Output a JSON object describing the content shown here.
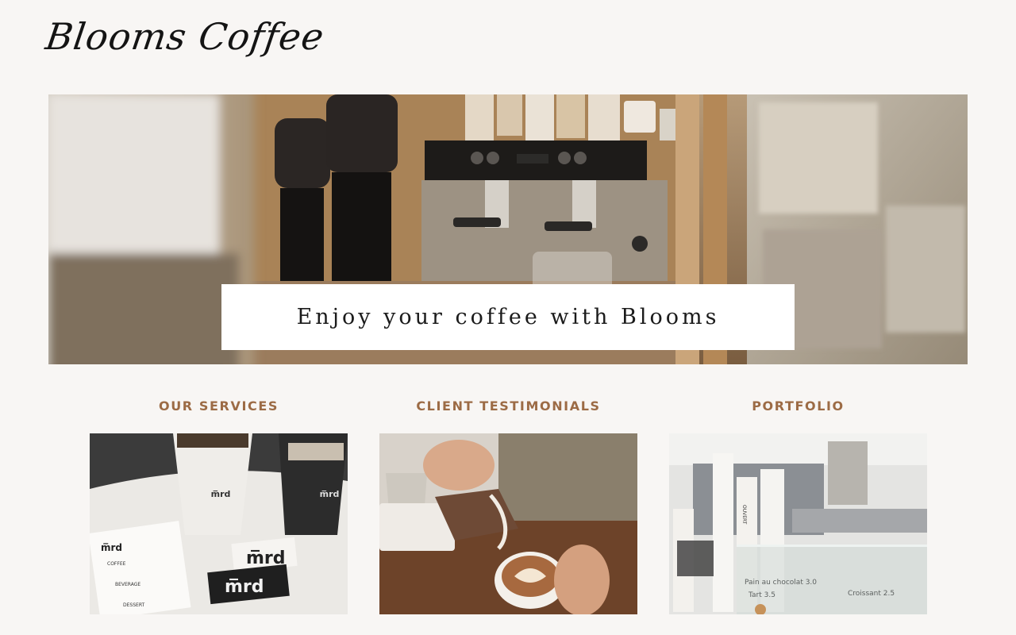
{
  "header": {
    "logo_text": "Blooms Coffee"
  },
  "hero": {
    "banner_text": "Enjoy your coffee with Blooms"
  },
  "sections": [
    {
      "title": "OUR SERVICES"
    },
    {
      "title": "CLIENT TESTIMONIALS"
    },
    {
      "title": "PORTFOLIO"
    }
  ],
  "photo_text": {
    "cup_brand": "m̅rd",
    "menu_brand": "m̅rd",
    "card_brand_1": "m̅rd",
    "card_brand_2": "m̅rd",
    "menu_coffee": "COFFEE",
    "menu_beverage": "BEVERAGE",
    "menu_dessert": "DESSERT",
    "cup_label": "OUVERT",
    "chalk_1": "Pain au chocolat 3.0",
    "chalk_2": "Tart 3.5",
    "chalk_3": "Croissant 2.5"
  },
  "colors": {
    "accent": "#9c6b45",
    "background": "#f8f6f4"
  }
}
